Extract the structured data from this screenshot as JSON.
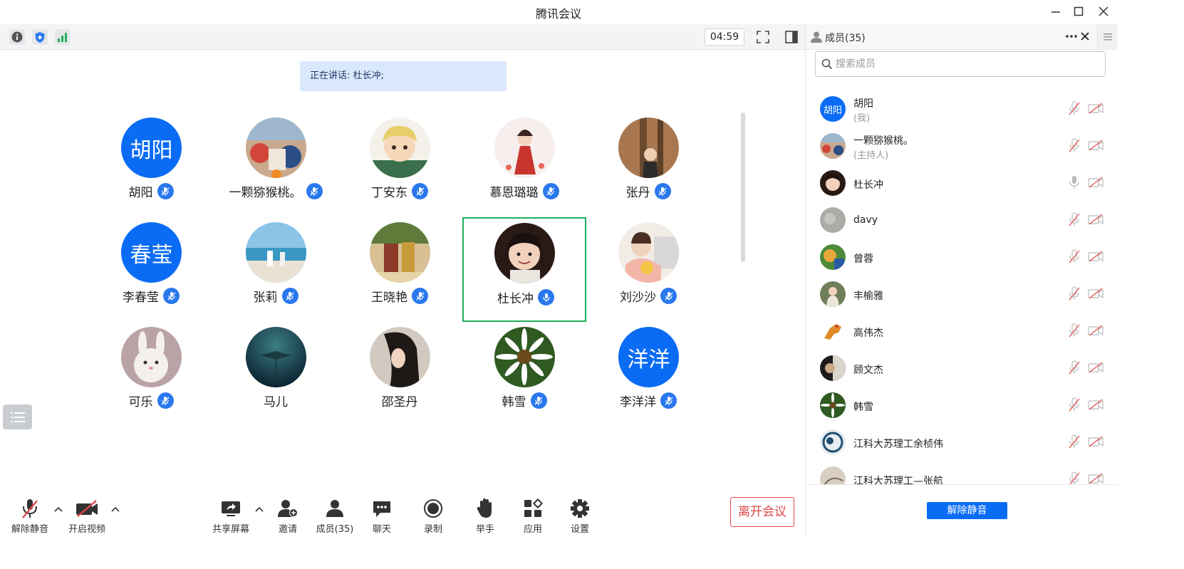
{
  "window": {
    "title": "腾讯会议"
  },
  "toolbar": {
    "timer": "04:59"
  },
  "stage": {
    "speaking_label": "正在讲话: 杜长冲;",
    "tiles": [
      {
        "name": "胡阳",
        "avatar_text": "胡阳",
        "muted": true
      },
      {
        "name": "一颗猕猴桃。",
        "avatar_text": "",
        "muted": true
      },
      {
        "name": "丁安东",
        "avatar_text": "",
        "muted": true
      },
      {
        "name": "慕恩璐璐",
        "avatar_text": "",
        "muted": true
      },
      {
        "name": "张丹",
        "avatar_text": "",
        "muted": true
      },
      {
        "name": "李春莹",
        "avatar_text": "春莹",
        "muted": true
      },
      {
        "name": "张莉",
        "avatar_text": "",
        "muted": true
      },
      {
        "name": "王晓艳",
        "avatar_text": "",
        "muted": true
      },
      {
        "name": "杜长冲",
        "avatar_text": "",
        "muted": false,
        "speaking": true
      },
      {
        "name": "刘沙沙",
        "avatar_text": "",
        "muted": true
      },
      {
        "name": "可乐",
        "avatar_text": "",
        "muted": true
      },
      {
        "name": "马儿",
        "avatar_text": "",
        "muted": null
      },
      {
        "name": "邵圣丹",
        "avatar_text": "",
        "muted": null
      },
      {
        "name": "韩雪",
        "avatar_text": "",
        "muted": true
      },
      {
        "name": "李洋洋",
        "avatar_text": "洋洋",
        "muted": true
      }
    ]
  },
  "bottombar": {
    "unmute_label": "解除静音",
    "video_label": "开启视频",
    "share_label": "共享屏幕",
    "invite_label": "邀请",
    "members_label": "成员(35)",
    "chat_label": "聊天",
    "record_label": "录制",
    "raise_hand_label": "举手",
    "apps_label": "应用",
    "settings_label": "设置",
    "leave_label": "离开会议"
  },
  "panel": {
    "title": "成员(35)",
    "search_placeholder": "搜索成员",
    "members": [
      {
        "name": "胡阳",
        "role": "(我)",
        "avatar_text": "胡阳"
      },
      {
        "name": "一颗猕猴桃。",
        "role": "(主持人)",
        "avatar_text": ""
      },
      {
        "name": "杜长冲",
        "role": "",
        "avatar_text": ""
      },
      {
        "name": "davy",
        "role": "",
        "avatar_text": ""
      },
      {
        "name": "曾蓉",
        "role": "",
        "avatar_text": ""
      },
      {
        "name": "丰榆雅",
        "role": "",
        "avatar_text": ""
      },
      {
        "name": "高伟杰",
        "role": "",
        "avatar_text": ""
      },
      {
        "name": "顾文杰",
        "role": "",
        "avatar_text": ""
      },
      {
        "name": "韩雪",
        "role": "",
        "avatar_text": ""
      },
      {
        "name": "江科大苏理工余桢伟",
        "role": "",
        "avatar_text": ""
      },
      {
        "name": "江科大苏理工—张航",
        "role": "",
        "avatar_text": ""
      }
    ],
    "unmute_all_label": "解除静音"
  },
  "colors": {
    "accent": "#0a6cf5",
    "leave": "#e04848",
    "active_border": "#22b05a",
    "speaking_bg": "#d9e8fb"
  },
  "icons": {
    "toolbar": [
      "info-icon",
      "shield-icon",
      "signal-icon",
      "fullscreen-icon",
      "side-layout-icon"
    ],
    "window": [
      "minimize-icon",
      "maximize-icon",
      "close-icon"
    ]
  }
}
